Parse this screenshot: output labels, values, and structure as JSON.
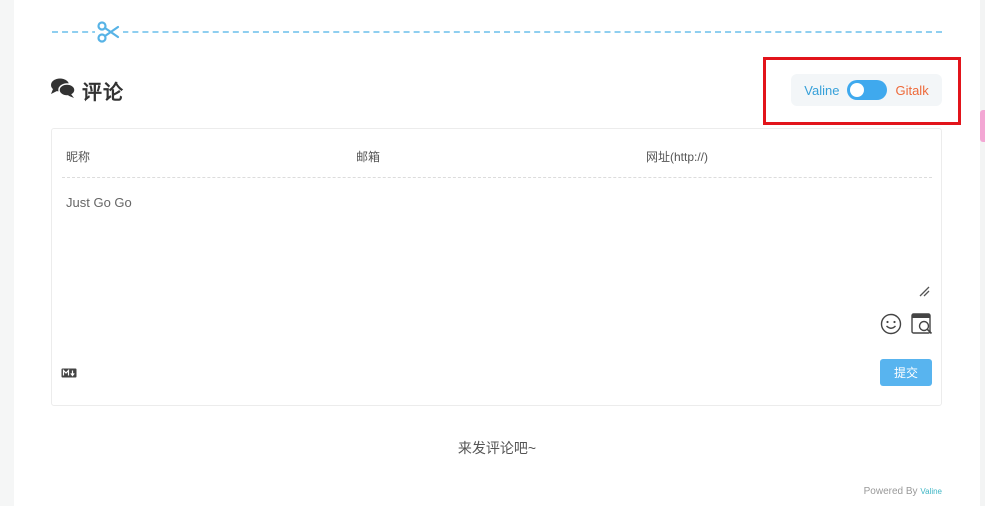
{
  "comments": {
    "title": "评论",
    "switch": {
      "left_label": "Valine",
      "right_label": "Gitalk",
      "active": "Valine"
    },
    "form": {
      "nick_placeholder": "昵称",
      "mail_placeholder": "邮箱",
      "link_placeholder": "网址(http://)",
      "textarea_placeholder": "Just Go Go",
      "submit_label": "提交"
    },
    "empty_message": "来发评论吧~",
    "powered_by_prefix": "Powered By",
    "powered_by_brand": "Valine"
  },
  "colors": {
    "accent": "#3fa9ee",
    "valine_label": "#36a0d9",
    "gitalk_label": "#ee6a3a",
    "highlight_box": "#e2141b",
    "submit_bg": "#58b4ef"
  },
  "icons": [
    "scissors-icon",
    "comments-icon",
    "emoji-icon",
    "preview-icon",
    "markdown-icon",
    "resize-grip-icon"
  ]
}
